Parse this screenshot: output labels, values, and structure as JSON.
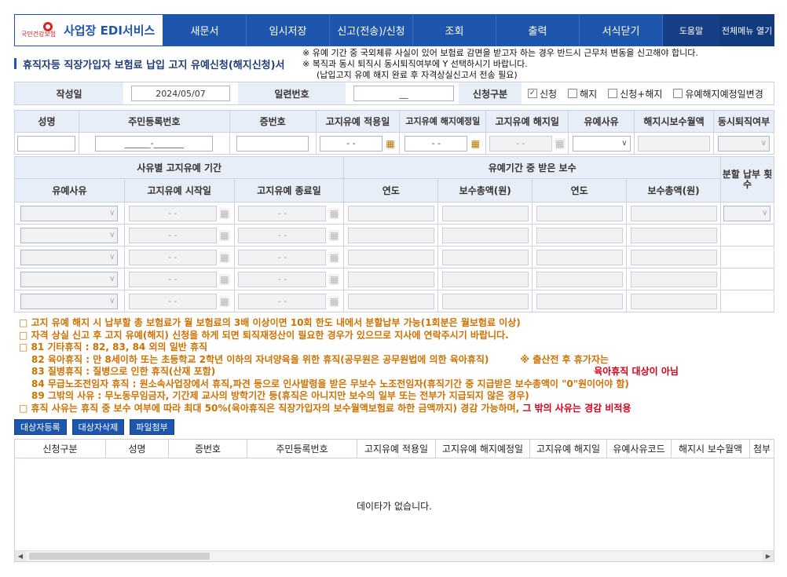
{
  "nav": {
    "logo_small": "국민건강보험",
    "service_name": "사업장 EDI서비스",
    "items": [
      "새문서",
      "임시저장",
      "신고(전송)/신청",
      "조회",
      "출력",
      "서식닫기"
    ],
    "help": "도움말",
    "all_menu": "전체메뉴 열기"
  },
  "page_title": "휴직자등 직장가입자 보험료 납입 고지 유예신청(해지신청)서",
  "notices": [
    "※ 유예 기간 중 국외체류 사실이 있어 보험료 감면을 받고자 하는 경우 반드시 근무처 변동을 신고해야 합니다.",
    "※ 복직과 동시 퇴직시 동시퇴직여부에 Y 선택하시기 바랍니다.",
    "(납입고지 유예 해지 완료 후 자격상실신고서 전송 필요)"
  ],
  "form": {
    "author_label": "작성일",
    "author_date": "2024/05/07",
    "serial_label": "일련번호",
    "serial_value": "__",
    "type_label": "신청구분",
    "options": [
      {
        "label": "신청",
        "checked": true
      },
      {
        "label": "해지",
        "checked": false
      },
      {
        "label": "신청+해지",
        "checked": false
      },
      {
        "label": "유예해지예정일변경",
        "checked": false
      }
    ]
  },
  "person_table": {
    "headers": [
      "성명",
      "주민등록번호",
      "증번호",
      "고지유예 적용일",
      "고지유예 해지예정일",
      "고지유예 해지일",
      "유예사유",
      "해지시보수월액",
      "동시퇴직여부"
    ],
    "rrn_placeholder": "______-_______",
    "date_placeholder": "-  -"
  },
  "period_table": {
    "group1": "사유별 고지유예 기간",
    "group2": "유예기간 중 받은 보수",
    "split_header": "분할 납부 횟수",
    "sub_headers": [
      "유예사유",
      "고지유예 시작일",
      "고지유예 종료일",
      "연도",
      "보수총액(원)",
      "연도",
      "보수총액(원)"
    ],
    "date_placeholder": "-  -"
  },
  "info": {
    "l1": "□ 고지 유예 해지 시 납부할 총 보험료가 월 보험료의 3배 이상이면 10회 한도 내에서 분할납부 가능(1회분은 월보험료 이상)",
    "l2": "□ 자격 상실 신고 후 고지 유예(해지) 신청을 하게 되면 퇴직재정산이 필요한 경우가 있으므로 지사에 연락주시기 바랍니다.",
    "l3": "□ 81 기타휴직 : 82, 83, 84 외의 일반 휴직",
    "l4": "82 육아휴직 : 만 8세이하 또는 초등학교 2학년 이하의 자녀양육을 위한 휴직(공무원은 공무원법에 의한 육아휴직)",
    "l4_note": "※ 출산전 후 휴가자는",
    "l5": "83 질병휴직 : 질병으로 인한 휴직(산재 포함)",
    "l5_note": "육아휴직 대상이 아님",
    "l6": "84 무급노조전임자 휴직 : 원소속사업장에서 휴직,파견 등으로 인사발령을 받은 무보수 노조전임자(휴직기간 중 지급받은 보수총액이 \"0\"원이어야 함)",
    "l7": "89 그밖의 사유 : 무노동무임금자, 기간제 교사의 방학기간 등(휴직은 아니지만 보수의 일부 또는 전부가 지급되지 않은 경우)",
    "l8": "□ 휴직 사유는 휴직 중 보수 여부에 따라 최대 50%(육아휴직은 직장가입자의 보수월액보험료 하한 금액까지) 경감 가능하며,",
    "l8_red": "그 밖의 사유는 경감 비적용"
  },
  "buttons": {
    "register": "대상자등록",
    "delete": "대상자삭제",
    "attach": "파일첨부"
  },
  "results": {
    "headers": [
      "신청구분",
      "성명",
      "증번호",
      "주민등록번호",
      "고지유예 적용일",
      "고지유예 해지예정일",
      "고지유예 해지일",
      "유예사유코드",
      "해지시 보수월액",
      "첨부"
    ],
    "empty": "데이타가 없습니다."
  }
}
